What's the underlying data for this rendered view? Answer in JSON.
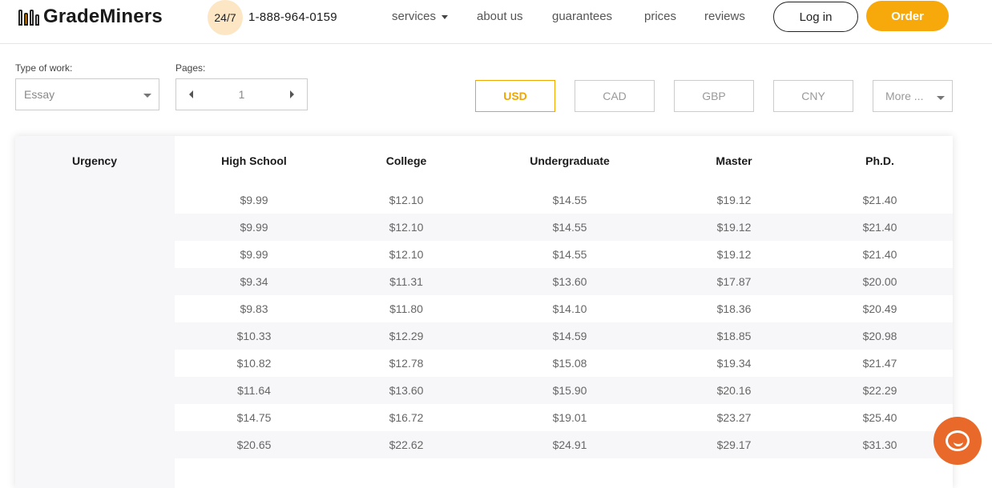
{
  "header": {
    "logo_text": "GradeMiners",
    "badge": "24/7",
    "phone": "1-888-964-0159",
    "nav": {
      "services": "services",
      "about": "about us",
      "guarantees": "guarantees",
      "prices": "prices",
      "reviews": "reviews"
    },
    "login_label": "Log in",
    "order_label": "Order"
  },
  "controls": {
    "type_label": "Type of work:",
    "type_value": "Essay",
    "pages_label": "Pages:",
    "pages_value": "1",
    "currencies": [
      "USD",
      "CAD",
      "GBP",
      "CNY"
    ],
    "active_currency": "USD",
    "more_label": "More ..."
  },
  "colors": {
    "accent": "#f7a80b",
    "chat": "#e8692a"
  },
  "table": {
    "headers": [
      "Urgency",
      "High School",
      "College",
      "Undergraduate",
      "Master",
      "Ph.D."
    ],
    "rows": [
      [
        "$9.99",
        "$12.10",
        "$14.55",
        "$19.12",
        "$21.40"
      ],
      [
        "$9.99",
        "$12.10",
        "$14.55",
        "$19.12",
        "$21.40"
      ],
      [
        "$9.99",
        "$12.10",
        "$14.55",
        "$19.12",
        "$21.40"
      ],
      [
        "$9.34",
        "$11.31",
        "$13.60",
        "$17.87",
        "$20.00"
      ],
      [
        "$9.83",
        "$11.80",
        "$14.10",
        "$18.36",
        "$20.49"
      ],
      [
        "$10.33",
        "$12.29",
        "$14.59",
        "$18.85",
        "$20.98"
      ],
      [
        "$10.82",
        "$12.78",
        "$15.08",
        "$19.34",
        "$21.47"
      ],
      [
        "$11.64",
        "$13.60",
        "$15.90",
        "$20.16",
        "$22.29"
      ],
      [
        "$14.75",
        "$16.72",
        "$19.01",
        "$23.27",
        "$25.40"
      ],
      [
        "$20.65",
        "$22.62",
        "$24.91",
        "$29.17",
        "$31.30"
      ]
    ]
  },
  "chat_icon": "chat-icon"
}
